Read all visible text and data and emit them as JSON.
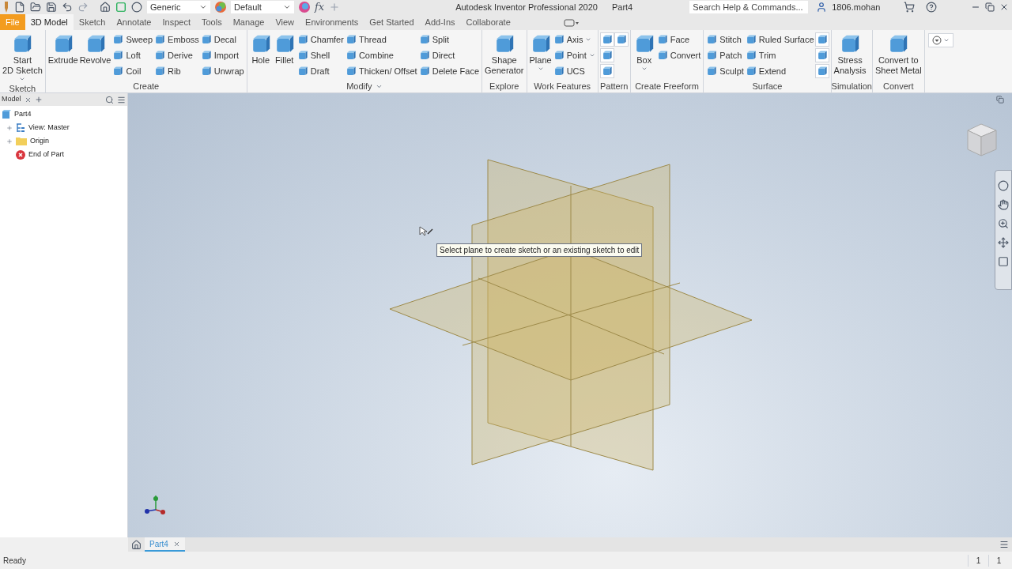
{
  "title_bar": {
    "material": "Generic",
    "appearance": "Default",
    "parameters_button": "fx",
    "title": "Autodesk Inventor Professional 2020",
    "document": "Part4",
    "search": {
      "placeholder": "Search Help & Commands..."
    },
    "user": "1806.mohan"
  },
  "ribbon_tabs": [
    {
      "label": "File",
      "selected": false,
      "kind": "file"
    },
    {
      "label": "3D Model",
      "selected": true,
      "kind": "tab"
    },
    {
      "label": "Sketch",
      "selected": false,
      "kind": "tab"
    },
    {
      "label": "Annotate",
      "selected": false,
      "kind": "tab"
    },
    {
      "label": "Inspect",
      "selected": false,
      "kind": "tab"
    },
    {
      "label": "Tools",
      "selected": false,
      "kind": "tab"
    },
    {
      "label": "Manage",
      "selected": false,
      "kind": "tab"
    },
    {
      "label": "View",
      "selected": false,
      "kind": "tab"
    },
    {
      "label": "Environments",
      "selected": false,
      "kind": "tab"
    },
    {
      "label": "Get Started",
      "selected": false,
      "kind": "tab"
    },
    {
      "label": "Add-Ins",
      "selected": false,
      "kind": "tab"
    },
    {
      "label": "Collaborate",
      "selected": false,
      "kind": "tab"
    }
  ],
  "ribbon_panels": [
    {
      "label": "Sketch",
      "menu": false,
      "columns": [
        {
          "kind": "large",
          "lines": [
            "Start",
            "2D Sketch"
          ],
          "dropdown": true
        }
      ]
    },
    {
      "label": "Create",
      "menu": false,
      "columns": [
        {
          "kind": "large",
          "lines": [
            "Extrude"
          ],
          "dropdown": false
        },
        {
          "kind": "large",
          "lines": [
            "Revolve"
          ],
          "dropdown": false
        },
        {
          "kind": "small",
          "items": [
            {
              "label": "Sweep",
              "dropdown": false
            },
            {
              "label": "Loft",
              "dropdown": false
            },
            {
              "label": "Coil",
              "dropdown": false
            }
          ]
        },
        {
          "kind": "small",
          "items": [
            {
              "label": "Emboss",
              "dropdown": false
            },
            {
              "label": "Derive",
              "dropdown": false
            },
            {
              "label": "Rib",
              "dropdown": false
            }
          ]
        },
        {
          "kind": "small",
          "items": [
            {
              "label": "Decal",
              "dropdown": false
            },
            {
              "label": "Import",
              "dropdown": false
            },
            {
              "label": "Unwrap",
              "dropdown": false
            }
          ]
        }
      ]
    },
    {
      "label": "Modify",
      "menu": true,
      "columns": [
        {
          "kind": "large",
          "lines": [
            "Hole"
          ],
          "dropdown": false
        },
        {
          "kind": "large",
          "lines": [
            "Fillet"
          ],
          "dropdown": false
        },
        {
          "kind": "small",
          "items": [
            {
              "label": "Chamfer",
              "dropdown": false
            },
            {
              "label": "Shell",
              "dropdown": false
            },
            {
              "label": "Draft",
              "dropdown": false
            }
          ]
        },
        {
          "kind": "small",
          "items": [
            {
              "label": "Thread",
              "dropdown": false
            },
            {
              "label": "Combine",
              "dropdown": false
            },
            {
              "label": "Thicken/ Offset",
              "dropdown": false
            }
          ]
        },
        {
          "kind": "small",
          "items": [
            {
              "label": "Split",
              "dropdown": false
            },
            {
              "label": "Direct",
              "dropdown": false
            },
            {
              "label": "Delete Face",
              "dropdown": false
            }
          ]
        }
      ]
    },
    {
      "label": "Explore",
      "menu": false,
      "columns": [
        {
          "kind": "large",
          "lines": [
            "Shape",
            "Generator"
          ],
          "dropdown": false
        }
      ]
    },
    {
      "label": "Work Features",
      "menu": false,
      "columns": [
        {
          "kind": "large",
          "lines": [
            "Plane"
          ],
          "dropdown": true
        },
        {
          "kind": "small",
          "items": [
            {
              "label": "Axis",
              "dropdown": true
            },
            {
              "label": "Point",
              "dropdown": true
            },
            {
              "label": "UCS",
              "dropdown": false
            }
          ]
        }
      ]
    },
    {
      "label": "Pattern",
      "menu": false,
      "columns": [
        {
          "kind": "small",
          "items": [
            {
              "dropdown": false
            },
            {
              "dropdown": false
            },
            {
              "dropdown": false
            }
          ]
        },
        {
          "kind": "small",
          "items": [
            {
              "dropdown": false
            }
          ]
        }
      ]
    },
    {
      "label": "Create Freeform",
      "menu": false,
      "columns": [
        {
          "kind": "large",
          "lines": [
            "Box"
          ],
          "dropdown": true
        },
        {
          "kind": "small",
          "items": [
            {
              "label": "Face",
              "dropdown": false
            },
            {
              "label": "Convert",
              "dropdown": false
            }
          ]
        }
      ]
    },
    {
      "label": "Surface",
      "menu": false,
      "columns": [
        {
          "kind": "small",
          "items": [
            {
              "label": "Stitch",
              "dropdown": false
            },
            {
              "label": "Patch",
              "dropdown": false
            },
            {
              "label": "Sculpt",
              "dropdown": false
            }
          ]
        },
        {
          "kind": "small",
          "items": [
            {
              "label": "Ruled Surface",
              "dropdown": false
            },
            {
              "label": "Trim",
              "dropdown": false
            },
            {
              "label": "Extend",
              "dropdown": false
            }
          ]
        },
        {
          "kind": "small",
          "items": [
            {
              "dropdown": false
            },
            {
              "dropdown": false
            },
            {
              "dropdown": false
            }
          ]
        }
      ]
    },
    {
      "label": "Simulation",
      "menu": false,
      "columns": [
        {
          "kind": "large",
          "lines": [
            "Stress",
            "Analysis"
          ],
          "dropdown": false
        }
      ]
    },
    {
      "label": "Convert",
      "menu": false,
      "columns": [
        {
          "kind": "large",
          "lines": [
            "Convert to",
            "Sheet Metal"
          ],
          "dropdown": false
        }
      ]
    }
  ],
  "browser": {
    "tab": "Model",
    "tree": [
      {
        "label": "Part4",
        "kind": "part",
        "children": [
          {
            "label": "View: Master",
            "kind": "view",
            "expanded": false
          },
          {
            "label": "Origin",
            "kind": "folder",
            "expanded": false
          },
          {
            "label": "End of Part",
            "kind": "end"
          }
        ]
      }
    ]
  },
  "viewport": {
    "tooltip": "Select plane to create sketch or an existing sketch to edit"
  },
  "document_tabs": [
    {
      "label": "Part4",
      "selected": true
    }
  ],
  "status_bar": {
    "message": "Ready",
    "counts": [
      "1",
      "1"
    ]
  }
}
